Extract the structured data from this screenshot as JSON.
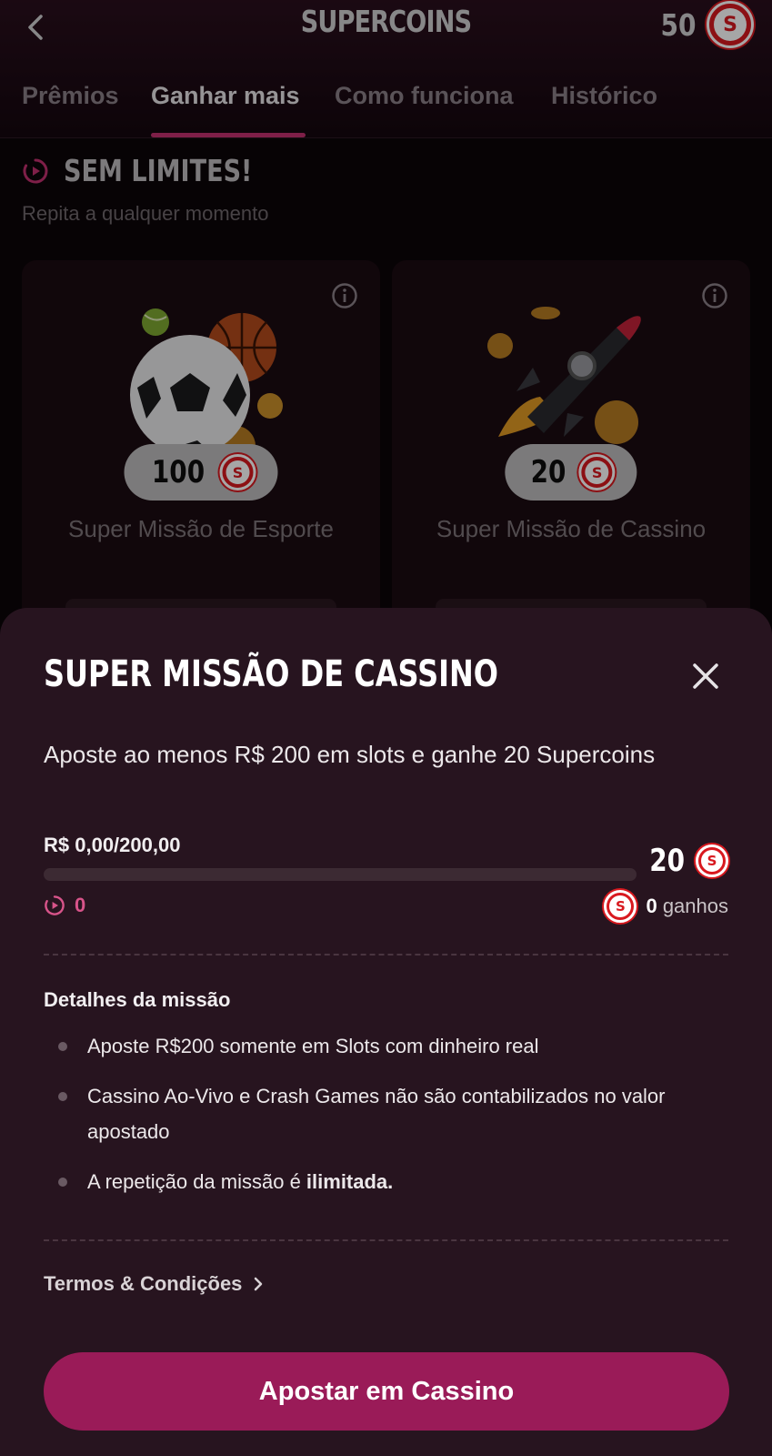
{
  "header": {
    "title": "SUPERCOINS",
    "balance": "50",
    "coin_symbol": "S"
  },
  "tabs": [
    {
      "label": "Prêmios",
      "active": false
    },
    {
      "label": "Ganhar mais",
      "active": true
    },
    {
      "label": "Como funciona",
      "active": false
    },
    {
      "label": "Histórico",
      "active": false
    }
  ],
  "section": {
    "title": "SEM LIMITES!",
    "subtitle": "Repita a qualquer momento"
  },
  "cards": [
    {
      "reward": "100",
      "label": "Super Missão de Esporte",
      "icon": "sports-balls-icon"
    },
    {
      "reward": "20",
      "label": "Super Missão de Cassino",
      "icon": "rocket-icon"
    }
  ],
  "sheet": {
    "title": "SUPER MISSÃO DE CASSINO",
    "description": "Aposte ao menos R$ 200 em slots e ganhe 20 Supercoins",
    "progress_label": "R$ 0,00/200,00",
    "progress_fraction": 0,
    "reward": "20",
    "repeat_count": "0",
    "earned_count": "0",
    "earned_label": "ganhos",
    "details_title": "Detalhes da missão",
    "details": [
      {
        "text": "Aposte R$200 somente em Slots com dinheiro real",
        "bold": ""
      },
      {
        "text": "Cassino Ao-Vivo e Crash Games não são contabilizados no valor apostado",
        "bold": ""
      },
      {
        "text": "A repetição da missão é ",
        "bold": "ilimitada."
      }
    ],
    "terms_label": "Termos & Condições",
    "cta_label": "Apostar em Cassino"
  },
  "colors": {
    "accent": "#c2306f",
    "cta": "#9a1b58",
    "coin": "#d8191f",
    "sheet_bg": "#27141f"
  }
}
